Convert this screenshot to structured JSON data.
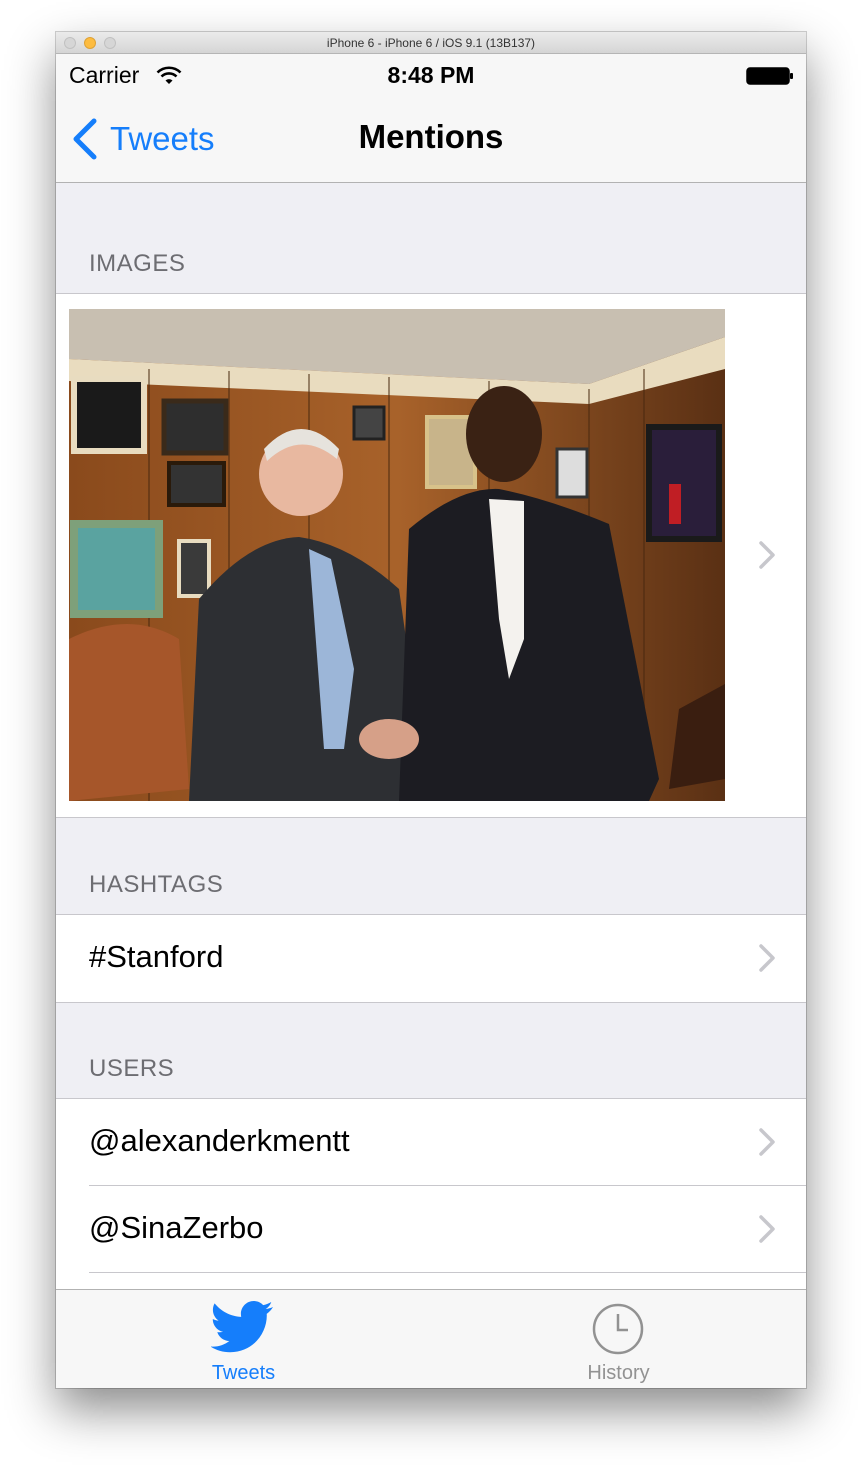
{
  "window": {
    "title": "iPhone 6 - iPhone 6 / iOS 9.1 (13B137)"
  },
  "status_bar": {
    "carrier": "Carrier",
    "time": "8:48 PM"
  },
  "nav_bar": {
    "back_label": "Tweets",
    "title": "Mentions"
  },
  "sections": {
    "images": {
      "header": "IMAGES"
    },
    "hashtags": {
      "header": "HASHTAGS",
      "items": [
        "#Stanford"
      ]
    },
    "users": {
      "header": "USERS",
      "items": [
        "@alexanderkmentt",
        "@SinaZerbo"
      ]
    }
  },
  "tab_bar": {
    "tabs": [
      {
        "label": "Tweets",
        "icon": "twitter-bird-icon",
        "selected": true
      },
      {
        "label": "History",
        "icon": "clock-icon",
        "selected": false
      }
    ]
  },
  "colors": {
    "accent": "#157efb",
    "inactive_tab": "#929292",
    "section_header": "#6d6d72",
    "background": "#efeff4"
  }
}
